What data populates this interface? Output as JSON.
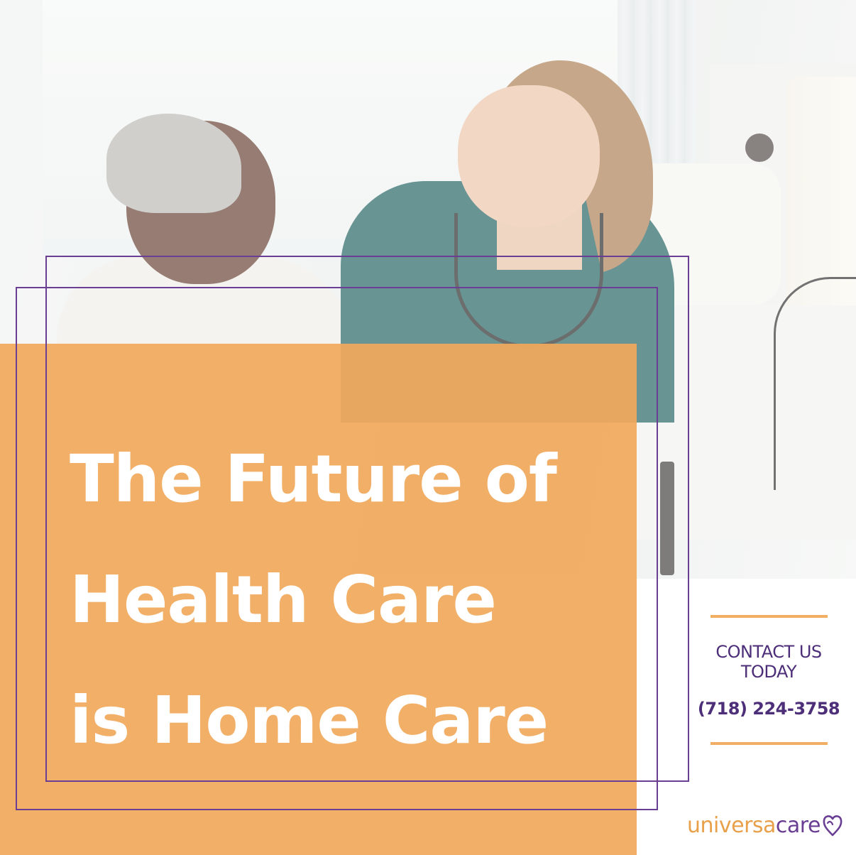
{
  "photo": {
    "description_icon": "caregiver-photo"
  },
  "headline": {
    "line1": "The Future of",
    "line2": "Health Care",
    "line3": "is Home Care"
  },
  "contact": {
    "line1": "CONTACT US",
    "line2": "TODAY",
    "phone": "(718) 224-3758"
  },
  "logo": {
    "part1": "universa",
    "part2": "care",
    "icon": "heart-outline-icon"
  },
  "colors": {
    "orange": "#f1a95c",
    "purple": "#6a3e93",
    "dark_purple": "#4d2e78",
    "white": "#ffffff"
  }
}
